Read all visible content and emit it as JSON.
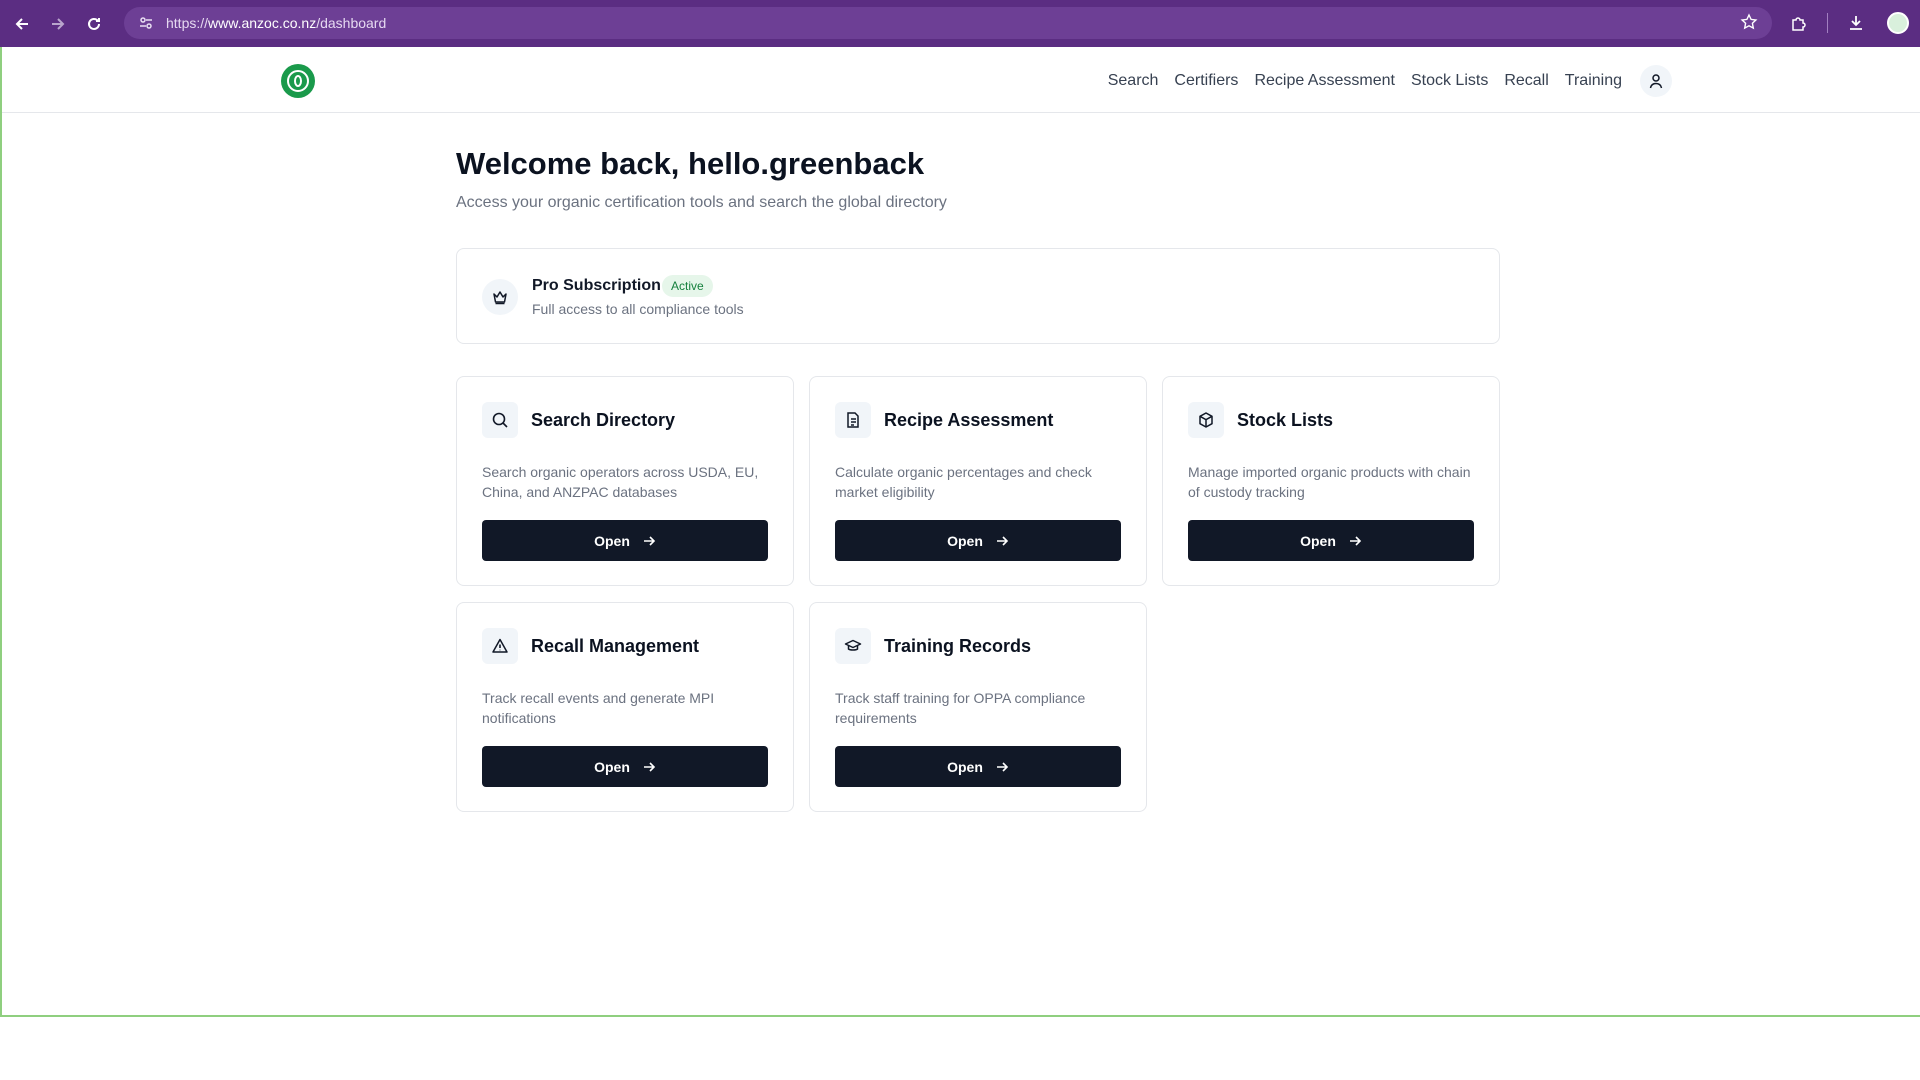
{
  "browser": {
    "url_prefix": "https://",
    "url_host": "www.anzoc.co.nz",
    "url_path": "/dashboard"
  },
  "nav": {
    "items": [
      {
        "label": "Search"
      },
      {
        "label": "Certifiers"
      },
      {
        "label": "Recipe Assessment"
      },
      {
        "label": "Stock Lists"
      },
      {
        "label": "Recall"
      },
      {
        "label": "Training"
      }
    ]
  },
  "main": {
    "welcome": "Welcome back, hello.greenback",
    "subtitle": "Access your organic certification tools and search the global directory"
  },
  "subscription": {
    "title": "Pro Subscription",
    "badge": "Active",
    "description": "Full access to all compliance tools"
  },
  "tools": [
    {
      "title": "Search Directory",
      "description": "Search organic operators across USDA, EU, China, and ANZPAC databases",
      "button": "Open",
      "icon": "search-icon"
    },
    {
      "title": "Recipe Assessment",
      "description": "Calculate organic percentages and check market eligibility",
      "button": "Open",
      "icon": "document-icon"
    },
    {
      "title": "Stock Lists",
      "description": "Manage imported organic products with chain of custody tracking",
      "button": "Open",
      "icon": "box-icon"
    },
    {
      "title": "Recall Management",
      "description": "Track recall events and generate MPI notifications",
      "button": "Open",
      "icon": "alert-triangle-icon"
    },
    {
      "title": "Training Records",
      "description": "Track staff training for OPPA compliance requirements",
      "button": "Open",
      "icon": "graduation-cap-icon"
    }
  ],
  "colors": {
    "browser_chrome": "#5b2d82",
    "brand_green": "#1a9a4b",
    "button_dark": "#111827",
    "active_badge_bg": "#e6f6ea",
    "active_badge_text": "#15803d"
  }
}
